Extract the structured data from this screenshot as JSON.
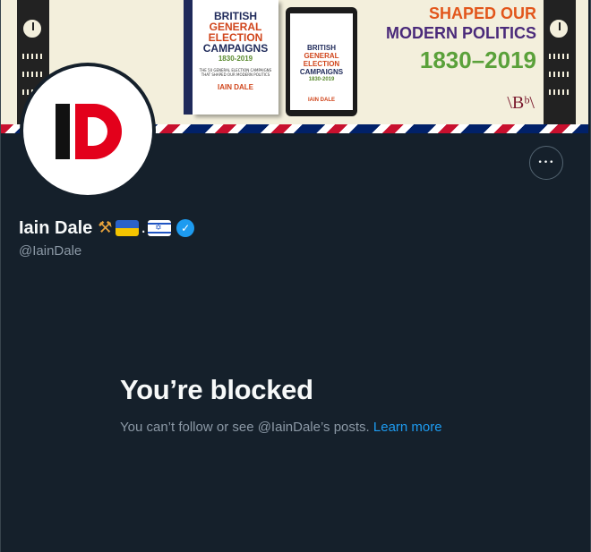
{
  "banner": {
    "book_cover_lines": [
      "BRITISH",
      "GENERAL",
      "ELECTION",
      "CAMPAIGNS",
      "1830-2019"
    ],
    "book_tagline": "THE 50 GENERAL ELECTION CAMPAIGNS THAT SHAPED OUR MODERN POLITICS",
    "book_author": "IAIN DALE",
    "headline_lines": [
      "SHAPED OUR",
      "MODERN POLITICS",
      "1830–2019"
    ],
    "publisher_mark": "\\Bᵇ\\",
    "colors": {
      "headline_orange": "#e2561b",
      "headline_purple": "#4a2a7a",
      "headline_green": "#5aa13a"
    }
  },
  "profile": {
    "avatar_letters": "ID",
    "name": "Iain Dale",
    "name_emojis": [
      "hammer-pick",
      "ukraine-flag",
      "dot",
      "israel-flag"
    ],
    "dot_text": ".",
    "verified_icon": "verified-badge-icon",
    "handle": "@IainDale",
    "more_button_label": "•••"
  },
  "blocked": {
    "title": "You’re blocked",
    "message": "You can’t follow or see @IainDale’s posts.",
    "link_text": "Learn more"
  },
  "colors": {
    "background": "#15202b",
    "accent": "#1d9bf0",
    "muted": "#8b98a5",
    "text": "#f7f9f9"
  }
}
